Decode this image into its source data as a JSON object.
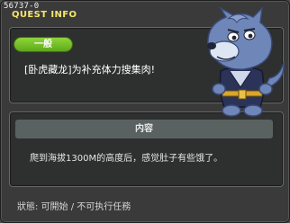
{
  "window": {
    "quest_id": "56737-0",
    "title": "QUEST INFO"
  },
  "quest": {
    "category": "一般",
    "name": "[卧虎藏龙]为补充体力搜集肉!"
  },
  "content": {
    "header": "内容",
    "description": "爬到海拔1300M的高度后，感觉肚子有些饿了。"
  },
  "status": {
    "text": "狀態: 可開始 / 不可执行任務"
  },
  "npc": {
    "icon": "wolf-npc-icon",
    "colors": {
      "fur": "#6f86b8",
      "robe": "#2b3358",
      "belt": "#d9a72a"
    }
  }
}
